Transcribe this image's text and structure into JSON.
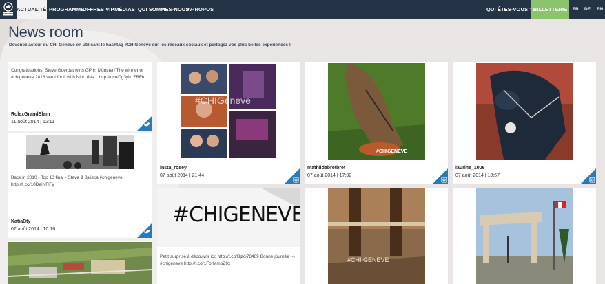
{
  "nav": {
    "items": [
      {
        "label": "ACTUALITÉS",
        "active": true
      },
      {
        "label": "PROGRAMME"
      },
      {
        "label": "OFFRES VIP"
      },
      {
        "label": "MÉDIAS"
      },
      {
        "label": "QUI SOMMES-NOUS?"
      },
      {
        "label": "A PROPOS"
      }
    ],
    "who": "QUI ÊTES-VOUS ? ▾",
    "billetterie": "BILLETTERIE",
    "langs": [
      "FR",
      "DE",
      "EN"
    ]
  },
  "page": {
    "title": "News room",
    "subtitle": "Devenez acteur du CHI Genève en utilisant le hashtag #CHIGeneve sur les réseaux sociaux et partagez vos plus belles expériences !"
  },
  "colors": {
    "nav_bg": "#253346",
    "accent_blue": "#2a7ab8",
    "billetterie": "#8cc46d",
    "page_bg": "#e9e5e4"
  },
  "feed": [
    {
      "network": "twitter-icon",
      "text": "Congratulations: Steve Guerdat wins GP in Münster! The winner of #chigeneve 2013 went for it with Nino des... http://t.co/0g3yb1ZBFh",
      "author": "RolexGrandSlam",
      "date": "11 août 2014 | 12:11"
    },
    {
      "network": "twitter-icon",
      "text1": "Back in 2010 - Top 10 final - Steve & Jalisca #chigeneve",
      "text2": "http://t.co/10DeiNFlFy",
      "author": "KatiaBty",
      "date": "07 août 2014 | 10:16"
    },
    {
      "network": "instagram-icon",
      "author": "insta_rosey",
      "date": "07 août 2014 | 21:44",
      "overlay": "#CHIGeneve"
    },
    {
      "network": "twitter-icon",
      "photo_text": "#CHIGENEVE",
      "text1": "Petit surprise à découvrir ici: http://t.co/Bjzci78469 Bonne journée ;-)",
      "text2": "#chigeneve http://t.co/1FbrMmpZ9x"
    },
    {
      "network": "instagram-icon",
      "author": "mathildebretbret",
      "date": "07 août 2014 | 17:32",
      "photo_text": "#CHIGENEVE"
    },
    {
      "network": "instagram-icon",
      "author": "laurine_1006",
      "date": "07 août 2014 | 10:57"
    },
    {
      "network": "instagram-icon",
      "photo_text": "#CHI GENEVE"
    },
    {
      "network": "instagram-icon"
    }
  ]
}
